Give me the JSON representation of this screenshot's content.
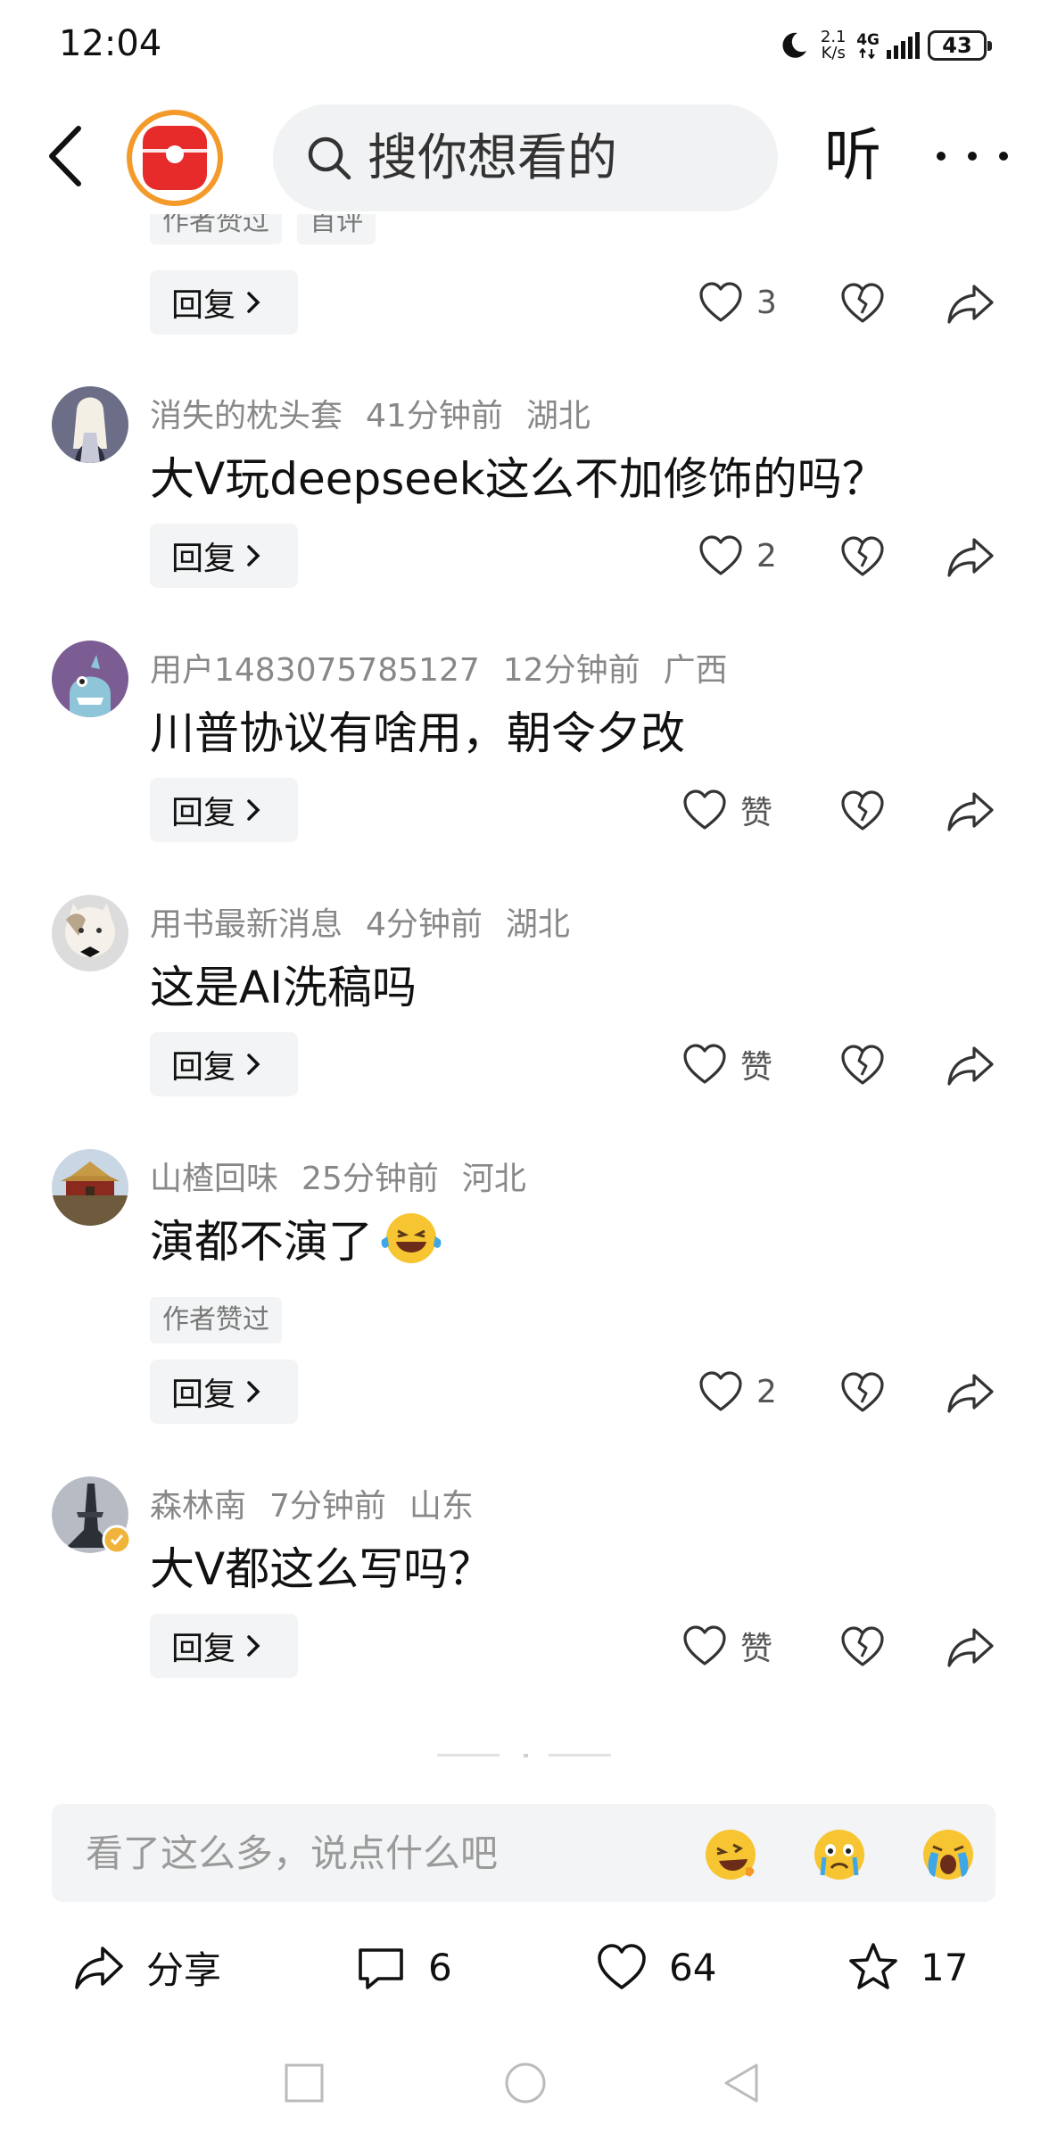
{
  "status_bar": {
    "time": "12:04",
    "net_speed_top": "2.1",
    "net_speed_bottom": "K/s",
    "network_type": "4G",
    "battery": "43"
  },
  "header": {
    "search_placeholder": "搜你想看的",
    "listen_label": "听",
    "logo_icon": "app-logo-icon"
  },
  "partial_tags": [
    "作者赞过",
    "首评"
  ],
  "comments": [
    {
      "actions": {
        "reply_label": "回复",
        "like_count": "3"
      }
    },
    {
      "username": "消失的枕头套",
      "time": "41分钟前",
      "location": "湖北",
      "text": "大V玩deepseek这么不加修饰的吗？",
      "actions": {
        "reply_label": "回复",
        "like_count": "2"
      }
    },
    {
      "username": "用户1483075785127",
      "time": "12分钟前",
      "location": "广西",
      "text": "川普协议有啥用，朝令夕改",
      "actions": {
        "reply_label": "回复",
        "like_count": "赞"
      }
    },
    {
      "username": "用书最新消息",
      "time": "4分钟前",
      "location": "湖北",
      "text": "这是AI洗稿吗",
      "actions": {
        "reply_label": "回复",
        "like_count": "赞"
      }
    },
    {
      "username": "山楂回味",
      "time": "25分钟前",
      "location": "河北",
      "text": "演都不演了",
      "emoji": "laughing-tears-emoji",
      "author_tag": "作者赞过",
      "actions": {
        "reply_label": "回复",
        "like_count": "2"
      }
    },
    {
      "username": "森林南",
      "time": "7分钟前",
      "location": "山东",
      "text": "大V都这么写吗？",
      "actions": {
        "reply_label": "回复",
        "like_count": "赞"
      }
    }
  ],
  "comment_bar": {
    "placeholder": "看了这么多，说点什么吧",
    "emojis": [
      "laughing-emoji",
      "crying-emoji",
      "sobbing-emoji"
    ]
  },
  "bottom_bar": {
    "share_label": "分享",
    "comment_count": "6",
    "like_count": "64",
    "favorite_count": "17"
  },
  "colors": {
    "accent_orange": "#f39a2b",
    "logo_red": "#e72a2a",
    "muted_text": "#888888",
    "chip_bg": "#f3f4f5"
  }
}
